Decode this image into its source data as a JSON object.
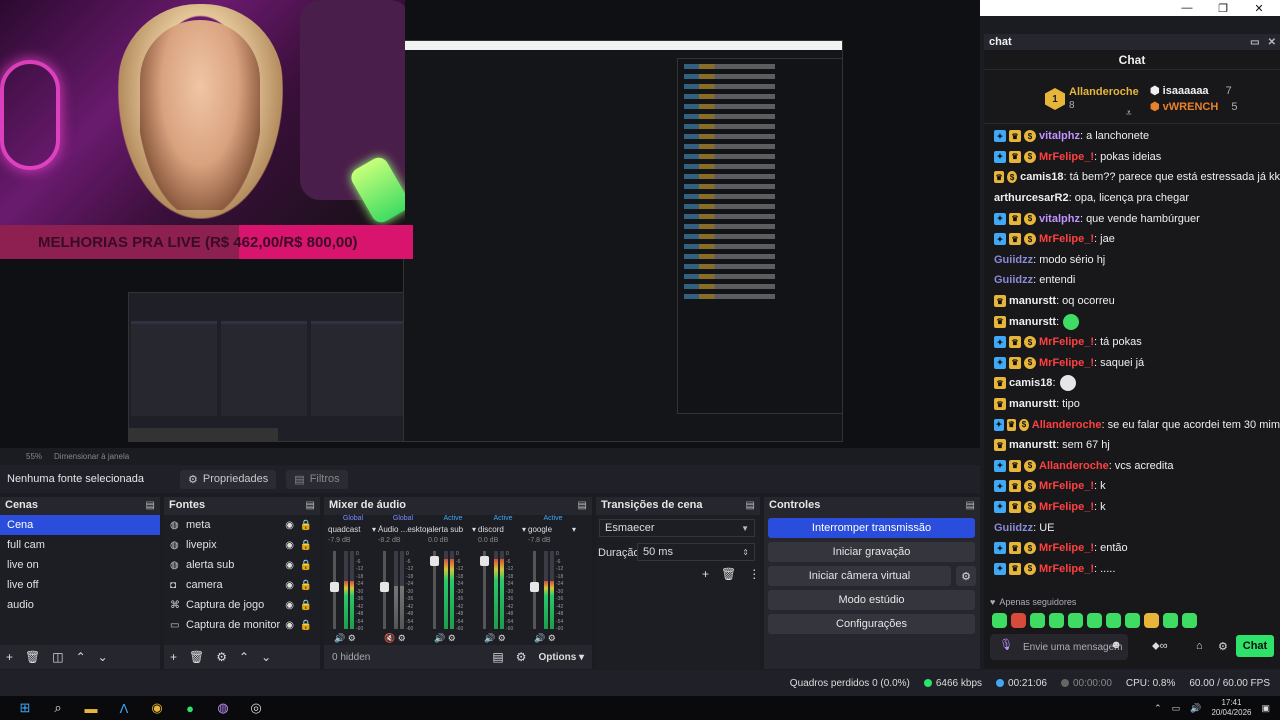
{
  "titlebar": {
    "minimize": "—",
    "restore": "❐",
    "close": "✕"
  },
  "preview": {
    "banner_text": "MELHORIAS PRA LIVE (R$ 462,00/R$ 800,00)",
    "banner_progress": 0.578,
    "zoom": "55%",
    "resize_hint": "Dimensionar à janela"
  },
  "source_bar": {
    "no_source": "Nenhuma fonte selecionada",
    "properties": "Propriedades",
    "filters": "Filtros"
  },
  "scenes": {
    "title": "Cenas",
    "items": [
      "Cena",
      "full cam",
      "live on",
      "live off",
      "audio"
    ],
    "selected": 0
  },
  "sources": {
    "title": "Fontes",
    "items": [
      {
        "label": "meta",
        "icon": "globe-icon"
      },
      {
        "label": "livepix",
        "icon": "globe-icon"
      },
      {
        "label": "alerta sub",
        "icon": "globe-icon"
      },
      {
        "label": "camera",
        "icon": "camera-icon"
      },
      {
        "label": "Captura de jogo",
        "icon": "gamepad-icon"
      },
      {
        "label": "Captura de monitor",
        "icon": "monitor-icon"
      }
    ]
  },
  "mixer": {
    "title": "Mixer de áudio",
    "channels": [
      {
        "state": "Global",
        "name": "quadcast",
        "db": "-7.9 dB",
        "level": 0.62,
        "fader": 0.55,
        "muted": false
      },
      {
        "state": "Global",
        "name": "Áudio ...esktop",
        "db": "-8.2 dB",
        "level": 0.55,
        "fader": 0.55,
        "muted": true
      },
      {
        "state": "Active",
        "name": "alerta sub",
        "db": "0.0 dB",
        "level": 0.9,
        "fader": 0.92,
        "muted": false
      },
      {
        "state": "Active",
        "name": "discord",
        "db": "0.0 dB",
        "level": 0.9,
        "fader": 0.92,
        "muted": false
      },
      {
        "state": "Active",
        "name": "google",
        "db": "-7.8 dB",
        "level": 0.62,
        "fader": 0.55,
        "muted": false
      }
    ],
    "scale": [
      "0",
      "-6",
      "-12",
      "-18",
      "-24",
      "-30",
      "-36",
      "-42",
      "-48",
      "-54",
      "-60"
    ],
    "hidden": "0 hidden",
    "options": "Options"
  },
  "transitions": {
    "title": "Transições de cena",
    "selected": "Esmaecer",
    "duration_label": "Duração",
    "duration_value": "50 ms"
  },
  "controls": {
    "title": "Controles",
    "buttons": [
      "Interromper transmissão",
      "Iniciar gravação",
      "Iniciar câmera virtual",
      "Modo estúdio",
      "Configurações"
    ]
  },
  "chat": {
    "window_title": "chat",
    "header": "Chat",
    "leaderboard": [
      {
        "rank": "1",
        "name": "Allanderoche",
        "score": "8"
      },
      {
        "rank": "2",
        "name": "isaaaaaa",
        "score": "7"
      },
      {
        "rank": "3",
        "name": "vWRENCH",
        "score": "5"
      }
    ],
    "messages": [
      {
        "user": "vitalphz",
        "color": "#bf94ff",
        "text": ": a lanchonete",
        "badges": [
          "prime",
          "crown",
          "sub"
        ]
      },
      {
        "user": "MrFelipe_!",
        "color": "#ff4040",
        "text": ": pokas ideias",
        "badges": [
          "prime",
          "crown",
          "sub"
        ]
      },
      {
        "user": "camis18",
        "color": "#efeff1",
        "text": ": tá bem?? parece que está estressada já kk",
        "badges": [
          "crown",
          "sub"
        ]
      },
      {
        "user": "arthurcesarR2",
        "color": "#efeff1",
        "text": ": opa, licença pra chegar",
        "badges": []
      },
      {
        "user": "vitalphz",
        "color": "#bf94ff",
        "text": ": que vende hambúrguer",
        "badges": [
          "prime",
          "crown",
          "sub"
        ]
      },
      {
        "user": "MrFelipe_!",
        "color": "#ff4040",
        "text": ": jae",
        "badges": [
          "prime",
          "crown",
          "sub"
        ]
      },
      {
        "user": "Guiidzz",
        "color": "#8a8ad8",
        "text": ": modo sério hj",
        "badges": []
      },
      {
        "user": "Guiidzz",
        "color": "#8a8ad8",
        "text": ": entendi",
        "badges": []
      },
      {
        "user": "manurstt",
        "color": "#efeff1",
        "text": ": oq ocorreu",
        "badges": [
          "crown"
        ]
      },
      {
        "user": "manurstt",
        "color": "#efeff1",
        "text": ":",
        "badges": [
          "crown"
        ],
        "emote": "#3fdc63"
      },
      {
        "user": "MrFelipe_!",
        "color": "#ff4040",
        "text": ": tá pokas",
        "badges": [
          "prime",
          "crown",
          "sub"
        ]
      },
      {
        "user": "MrFelipe_!",
        "color": "#ff4040",
        "text": ": saquei já",
        "badges": [
          "prime",
          "crown",
          "sub"
        ]
      },
      {
        "user": "camis18",
        "color": "#efeff1",
        "text": ":",
        "badges": [
          "crown"
        ],
        "emote": "#e6e6e6"
      },
      {
        "user": "manurstt",
        "color": "#efeff1",
        "text": ": tipo",
        "badges": [
          "crown"
        ]
      },
      {
        "user": "Allanderoche",
        "color": "#ff4040",
        "text": ": se eu falar que acordei tem 30 mim",
        "badges": [
          "prime",
          "crown",
          "sub"
        ]
      },
      {
        "user": "manurstt",
        "color": "#efeff1",
        "text": ": sem 67 hj",
        "badges": [
          "crown"
        ]
      },
      {
        "user": "Allanderoche",
        "color": "#ff4040",
        "text": ": vcs acredita",
        "badges": [
          "prime",
          "crown",
          "sub"
        ]
      },
      {
        "user": "MrFelipe_!",
        "color": "#ff4040",
        "text": ": k",
        "badges": [
          "prime",
          "crown",
          "sub"
        ]
      },
      {
        "user": "MrFelipe_!",
        "color": "#ff4040",
        "text": ": k",
        "badges": [
          "prime",
          "crown",
          "sub"
        ]
      },
      {
        "user": "Guiidzz",
        "color": "#8a8ad8",
        "text": ": UE",
        "badges": []
      },
      {
        "user": "MrFelipe_!",
        "color": "#ff4040",
        "text": ": então",
        "badges": [
          "prime",
          "crown",
          "sub"
        ]
      },
      {
        "user": "MrFelipe_!",
        "color": "#ff4040",
        "text": ": .....",
        "badges": [
          "prime",
          "crown",
          "sub"
        ]
      }
    ],
    "followers_only": "Apenas seguidores",
    "input_placeholder": "Envie uma mensagem",
    "send": "Chat"
  },
  "status": {
    "dropped": "Quadros perdidos 0 (0.0%)",
    "bitrate": "6466 kbps",
    "stream_time": "00:21:06",
    "rec_time": "00:00:00",
    "cpu": "CPU: 0.8%",
    "fps": "60.00 / 60.00 FPS",
    "accent": "#2ee36a"
  },
  "taskbar": {
    "time": "17:41",
    "date": "20/04/2026"
  }
}
